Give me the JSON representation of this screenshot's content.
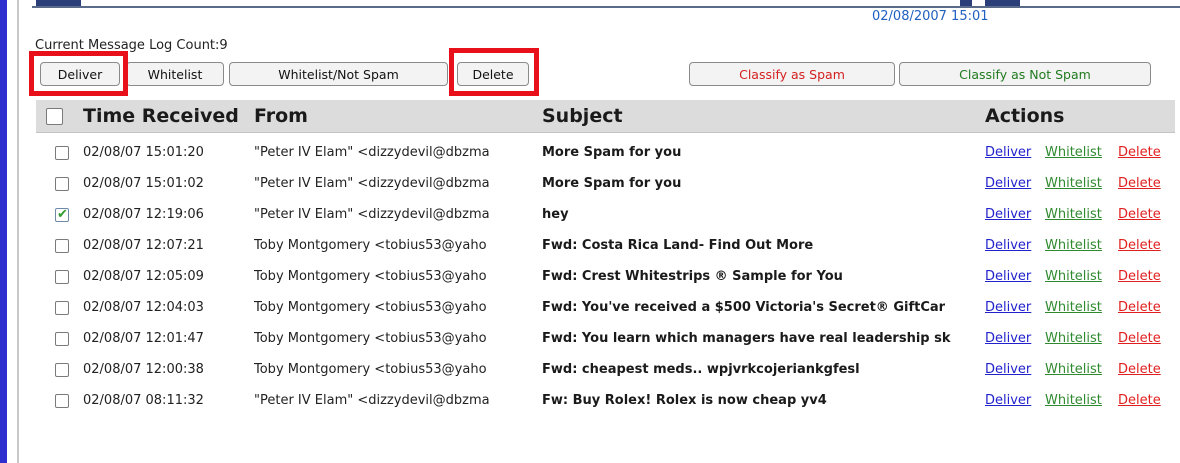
{
  "header": {
    "datetime": "02/08/2007 15:01",
    "log_count": "Current Message Log Count:9"
  },
  "toolbar": {
    "deliver": "Deliver",
    "whitelist": "Whitelist",
    "whitelist_not_spam": "Whitelist/Not Spam",
    "delete": "Delete",
    "classify_spam": "Classify as Spam",
    "classify_not_spam": "Classify as Not Spam"
  },
  "colors": {
    "highlight": "#e8101a",
    "spam_text": "#d42020",
    "not_spam_text": "#1f7a1f",
    "datetime_text": "#2060c0"
  },
  "table": {
    "columns": {
      "time": "Time Received",
      "from": "From",
      "subject": "Subject",
      "actions": "Actions"
    },
    "action_labels": {
      "deliver": "Deliver",
      "whitelist": "Whitelist",
      "delete": "Delete"
    },
    "rows": [
      {
        "checked": false,
        "time": "02/08/07 15:01:20",
        "from": "\"Peter IV Elam\" <dizzydevil@dbzma",
        "subject": "More Spam for you"
      },
      {
        "checked": false,
        "time": "02/08/07 15:01:02",
        "from": "\"Peter IV Elam\" <dizzydevil@dbzma",
        "subject": "More Spam for you"
      },
      {
        "checked": true,
        "time": "02/08/07 12:19:06",
        "from": "\"Peter IV Elam\" <dizzydevil@dbzma",
        "subject": "hey"
      },
      {
        "checked": false,
        "time": "02/08/07 12:07:21",
        "from": "Toby Montgomery <tobius53@yaho",
        "subject": "Fwd: Costa Rica Land- Find Out More"
      },
      {
        "checked": false,
        "time": "02/08/07 12:05:09",
        "from": "Toby Montgomery <tobius53@yaho",
        "subject": "Fwd: Crest Whitestrips ® Sample for You"
      },
      {
        "checked": false,
        "time": "02/08/07 12:04:03",
        "from": "Toby Montgomery <tobius53@yaho",
        "subject": "Fwd: You've received a $500 Victoria's Secret® GiftCar"
      },
      {
        "checked": false,
        "time": "02/08/07 12:01:47",
        "from": "Toby Montgomery <tobius53@yaho",
        "subject": "Fwd: You learn which managers have real leadership sk"
      },
      {
        "checked": false,
        "time": "02/08/07 12:00:38",
        "from": "Toby Montgomery <tobius53@yaho",
        "subject": "Fwd: cheapest meds.. wpjvrkcojeriankgfesl"
      },
      {
        "checked": false,
        "time": "02/08/07 08:11:32",
        "from": "\"Peter IV Elam\" <dizzydevil@dbzma",
        "subject": "Fw: Buy Rolex! Rolex is now cheap yv4"
      }
    ]
  }
}
